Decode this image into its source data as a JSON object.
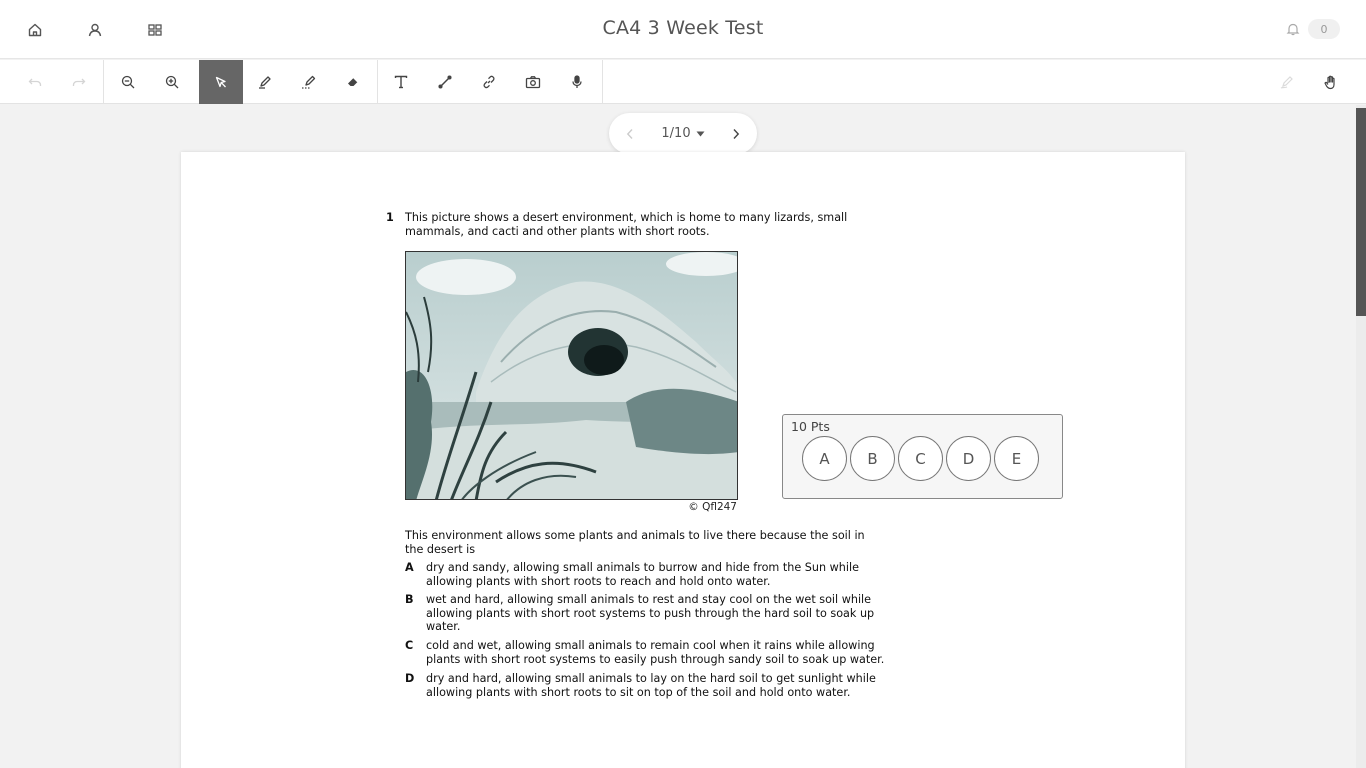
{
  "header": {
    "title": "CA4 3 Week Test",
    "notification_count": "0"
  },
  "pager": {
    "label": "1/10"
  },
  "question": {
    "number": "1",
    "stem": "This picture shows a desert environment, which is home to many lizards, small mammals, and cacti and other plants with short roots.",
    "image_credit": "© Qfl247",
    "prompt": "This environment allows some plants and animals to live there because the soil in the desert is",
    "options": [
      {
        "letter": "A",
        "text": "dry and sandy, allowing small animals to burrow and hide from the Sun while allowing plants with short roots to reach and hold onto water."
      },
      {
        "letter": "B",
        "text": "wet and hard, allowing small animals to rest and stay cool on the wet soil while allowing plants with short root systems to push through the hard soil to soak up water."
      },
      {
        "letter": "C",
        "text": "cold and wet, allowing small animals to remain cool when it rains while allowing plants with short root systems to easily push through sandy soil to soak up water."
      },
      {
        "letter": "D",
        "text": "dry and hard, allowing small animals to lay on the hard soil to get sunlight while allowing plants with short roots to sit on top of the soil and hold onto water."
      }
    ]
  },
  "answer_panel": {
    "points_label": "10 Pts",
    "choices": [
      "A",
      "B",
      "C",
      "D",
      "E"
    ]
  },
  "colors": {
    "active_tool": "#666666",
    "page_background": "#f2f2f2",
    "scroll_thumb": "#555555"
  },
  "icons": {
    "nav": [
      "home-icon",
      "user-icon",
      "grid-icon"
    ],
    "tools": [
      "undo-icon",
      "redo-icon",
      "zoom-out-icon",
      "zoom-in-icon",
      "select-icon",
      "pen-icon",
      "highlighter-icon",
      "eraser-icon",
      "text-icon",
      "line-icon",
      "link-icon",
      "camera-icon",
      "microphone-icon",
      "signature-icon",
      "hand-icon"
    ]
  }
}
